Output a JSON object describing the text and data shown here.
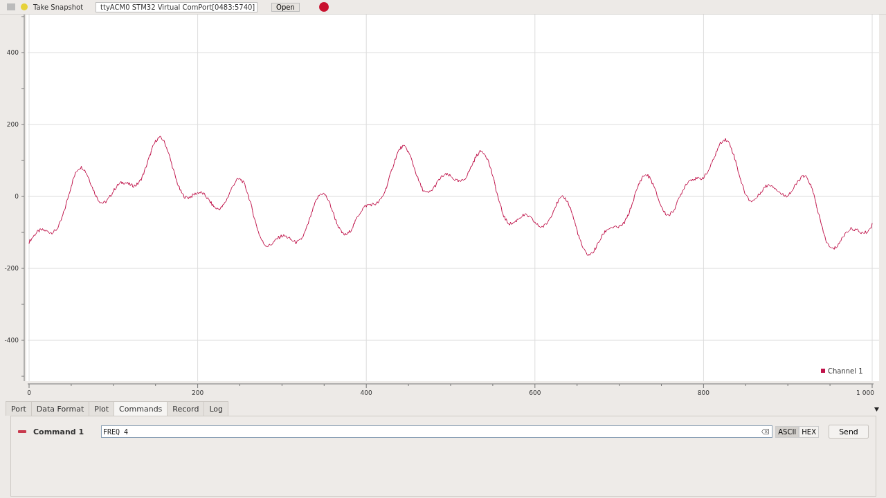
{
  "toolbar": {
    "snapshot_button": "Take Snapshot",
    "port_select": "ttyACM0 STM32 Virtual ComPort[0483:5740]",
    "open_button": "Open"
  },
  "plot": {
    "y_axis_labels": [
      "400",
      "200",
      "0",
      "-200",
      "-400"
    ],
    "x_axis_labels": [
      "0",
      "200",
      "400",
      "600",
      "800",
      "1 000"
    ],
    "legend": [
      {
        "name": "Channel 1",
        "color": "#c0134a"
      }
    ]
  },
  "tabs": [
    {
      "label": "Port",
      "selected": false
    },
    {
      "label": "Data Format",
      "selected": false
    },
    {
      "label": "Plot",
      "selected": false
    },
    {
      "label": "Commands",
      "selected": true
    },
    {
      "label": "Record",
      "selected": false
    },
    {
      "label": "Log",
      "selected": false
    }
  ],
  "commands": [
    {
      "name": "Command 1",
      "value": "FREQ 4",
      "modes": [
        {
          "label": "ASCII",
          "selected": true
        },
        {
          "label": "HEX",
          "selected": false
        }
      ],
      "send": "Send"
    }
  ]
}
